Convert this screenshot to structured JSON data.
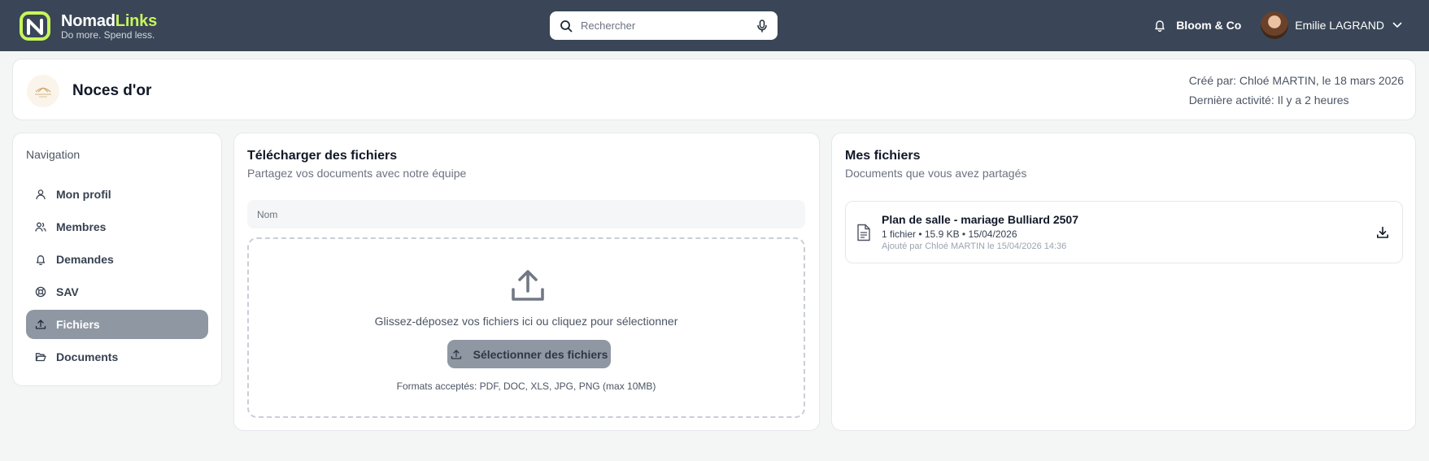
{
  "brand": {
    "name_part1": "Nomad",
    "name_part2": "Links",
    "tagline": "Do more. Spend less."
  },
  "search": {
    "placeholder": "Rechercher"
  },
  "topbar": {
    "org_name": "Bloom & Co",
    "user_name": "Emilie LAGRAND"
  },
  "event": {
    "title": "Noces d'or",
    "created_by": "Créé par: Chloé MARTIN, le 18 mars 2026",
    "last_activity": "Dernière activité: Il y a 2 heures"
  },
  "navigation": {
    "heading": "Navigation",
    "items": [
      {
        "label": "Mon profil",
        "icon": "user-icon"
      },
      {
        "label": "Membres",
        "icon": "users-icon"
      },
      {
        "label": "Demandes",
        "icon": "bell-icon"
      },
      {
        "label": "SAV",
        "icon": "lifebuoy-icon"
      },
      {
        "label": "Fichiers",
        "icon": "upload-icon",
        "active": true
      },
      {
        "label": "Documents",
        "icon": "folder-open-icon"
      }
    ]
  },
  "upload": {
    "title": "Télécharger des fichiers",
    "subtitle": "Partagez vos documents avec notre équipe",
    "name_placeholder": "Nom",
    "drop_text": "Glissez-déposez vos fichiers ici ou cliquez pour sélectionner",
    "button_label": "Sélectionner des fichiers",
    "formats": "Formats acceptés: PDF, DOC, XLS, JPG, PNG (max 10MB)"
  },
  "my_files": {
    "title": "Mes fichiers",
    "subtitle": "Documents que vous avez partagés",
    "items": [
      {
        "name": "Plan de salle - mariage Bulliard 2507",
        "info": "1 fichier • 15.9 KB • 15/04/2026",
        "added": "Ajouté par Chloé MARTIN le 15/04/2026 14:36"
      }
    ]
  },
  "colors": {
    "topbar": "#3a4657",
    "accent": "#c8f55a",
    "active_nav": "#8f97a3",
    "background": "#f4f6f5"
  }
}
